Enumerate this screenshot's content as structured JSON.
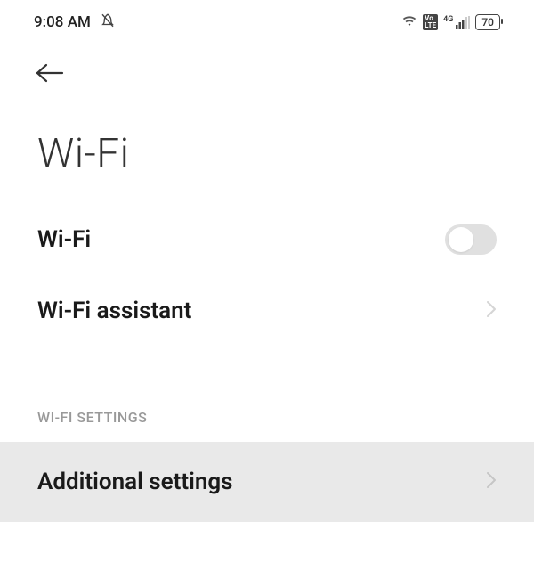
{
  "statusBar": {
    "time": "9:08 AM",
    "battery": "70",
    "networkType": "4G",
    "volte": "VoLTE"
  },
  "header": {
    "pageTitle": "Wi-Fi"
  },
  "settings": {
    "wifiToggle": {
      "label": "Wi-Fi",
      "enabled": false
    },
    "wifiAssistant": {
      "label": "Wi-Fi assistant"
    },
    "sectionHeader": "WI-FI SETTINGS",
    "additionalSettings": {
      "label": "Additional settings"
    }
  }
}
